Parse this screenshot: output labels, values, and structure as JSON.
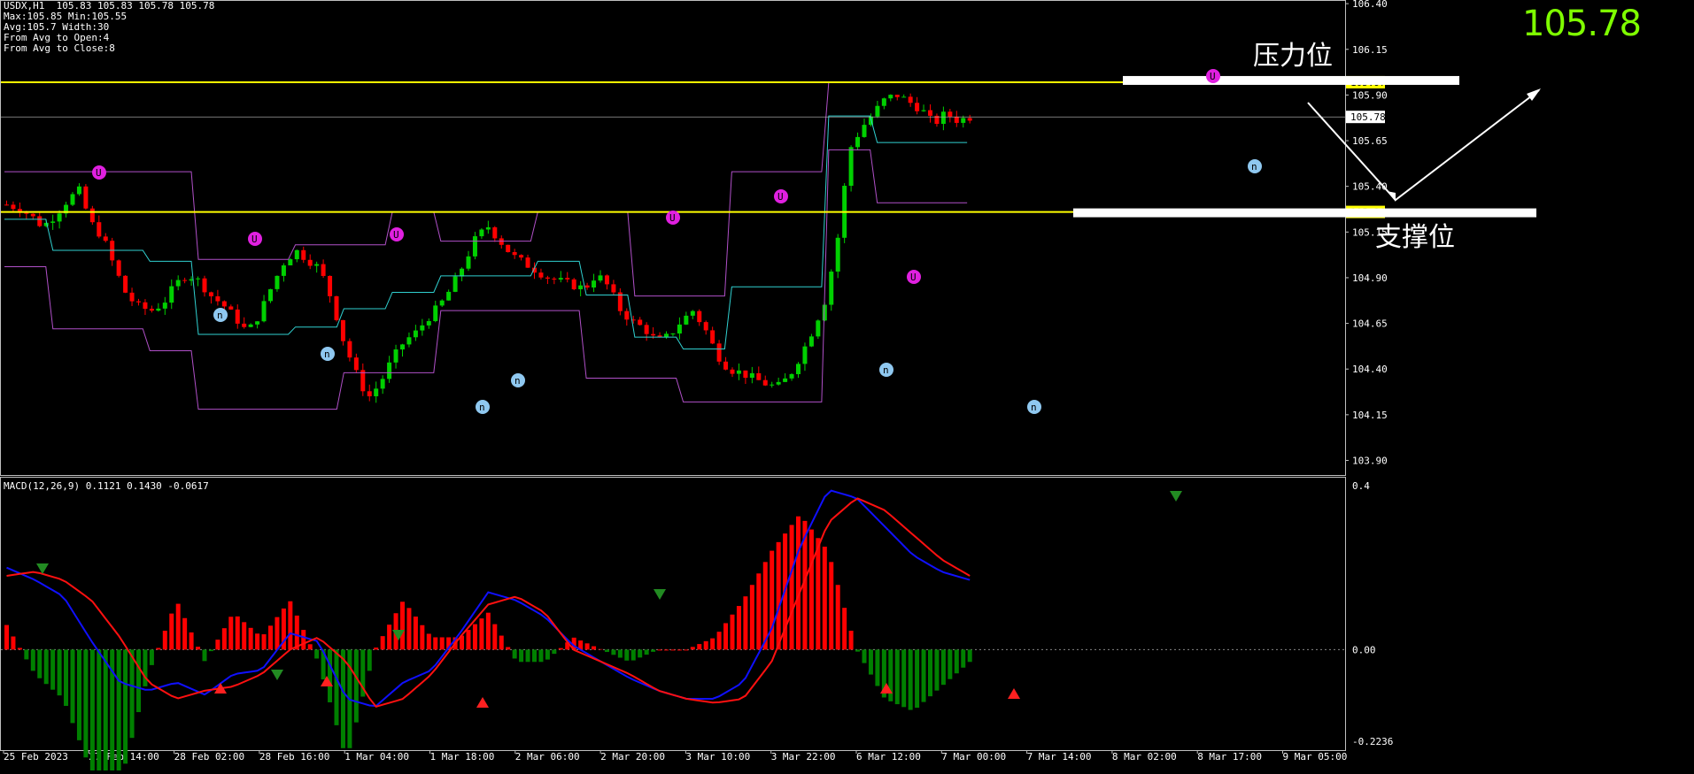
{
  "header": {
    "symbol_line": "USDX,H1  105.83 105.83 105.78 105.78",
    "max_min": "Max:105.85 Min:105.55",
    "avg_width": "Avg:105.7 Width:30",
    "from_open": "From Avg to Open:4",
    "from_close": "From Avg to Close:8"
  },
  "current_price": "105.78",
  "annotations": {
    "resistance": "压力位",
    "support": "支撑位"
  },
  "colors": {
    "up": "#00d000",
    "down": "#ff0000",
    "level": "#ffff00",
    "channel": "#b050c8",
    "mid": "#30d0d0",
    "macd_line": "#1010ff",
    "signal_line": "#ff1010",
    "hist_pos": "#ff0000",
    "hist_neg": "#008000"
  },
  "macd_title": "MACD(12,26,9) 0.1121 0.1430 -0.0617",
  "chart_data": [
    {
      "type": "candlestick",
      "symbol": "USDX",
      "timeframe": "H1",
      "y_ticks": [
        "106.40",
        "106.15",
        "105.90",
        "105.65",
        "105.40",
        "105.15",
        "104.90",
        "104.65",
        "104.40",
        "104.15",
        "103.90"
      ],
      "ylim": [
        103.82,
        106.42
      ],
      "x_ticks": [
        "25 Feb 2023",
        "27 Feb 14:00",
        "28 Feb 02:00",
        "28 Feb 16:00",
        "1 Mar 04:00",
        "1 Mar 18:00",
        "2 Mar 06:00",
        "2 Mar 20:00",
        "3 Mar 10:00",
        "3 Mar 22:00",
        "6 Mar 12:00",
        "7 Mar 00:00",
        "7 Mar 14:00",
        "8 Mar 02:00",
        "8 Mar 17:00",
        "9 Mar 05:00"
      ],
      "levels": [
        {
          "label": "105.97",
          "value": 105.97
        },
        {
          "label": "105.78",
          "value": 105.78
        },
        {
          "label": "105.26",
          "value": 105.26
        }
      ],
      "anchor_closes": [
        105.3,
        105.28,
        105.24,
        105.18,
        105.24,
        105.32,
        105.38,
        105.2,
        105.12,
        104.95,
        104.8,
        104.74,
        104.72,
        104.76,
        104.86,
        104.92,
        104.88,
        104.8,
        104.75,
        104.68,
        104.6,
        104.7,
        104.85,
        104.98,
        105.05,
        105.0,
        104.95,
        104.78,
        104.55,
        104.38,
        104.24,
        104.32,
        104.45,
        104.55,
        104.6,
        104.68,
        104.75,
        104.85,
        104.98,
        105.12,
        105.18,
        105.1,
        105.02,
        104.98,
        104.94,
        104.9,
        104.88,
        104.86,
        104.84,
        104.92,
        104.85,
        104.72,
        104.66,
        104.62,
        104.55,
        104.58,
        104.66,
        104.72,
        104.62,
        104.48,
        104.4,
        104.38,
        104.35,
        104.32,
        104.3,
        104.36,
        104.48,
        104.62,
        104.78,
        105.1,
        105.6,
        105.72,
        105.8,
        105.88,
        105.9,
        105.86,
        105.82,
        105.74,
        105.8,
        105.76,
        105.78
      ],
      "high": 105.98,
      "low": 104.14
    },
    {
      "type": "macd",
      "params": "12,26,9",
      "ylim": [
        -0.2236,
        0.4
      ],
      "y_ticks": [
        "0.4",
        "0.00",
        "-0.2236"
      ],
      "macd_anchors": [
        0.2,
        0.17,
        0.13,
        0.02,
        -0.08,
        -0.1,
        -0.08,
        -0.11,
        -0.06,
        -0.05,
        0.04,
        0.02,
        -0.12,
        -0.14,
        -0.08,
        -0.05,
        0.04,
        0.14,
        0.12,
        0.08,
        0.01,
        -0.03,
        -0.07,
        -0.1,
        -0.12,
        -0.12,
        -0.08,
        0.05,
        0.25,
        0.39,
        0.37,
        0.3,
        0.23,
        0.19,
        0.17
      ],
      "signal_anchors": [
        0.18,
        0.19,
        0.17,
        0.12,
        0.03,
        -0.08,
        -0.12,
        -0.1,
        -0.09,
        -0.06,
        0.0,
        0.03,
        -0.03,
        -0.14,
        -0.12,
        -0.06,
        0.03,
        0.11,
        0.13,
        0.09,
        0.0,
        -0.03,
        -0.06,
        -0.1,
        -0.12,
        -0.13,
        -0.12,
        -0.03,
        0.14,
        0.31,
        0.37,
        0.34,
        0.28,
        0.22,
        0.18
      ]
    }
  ]
}
